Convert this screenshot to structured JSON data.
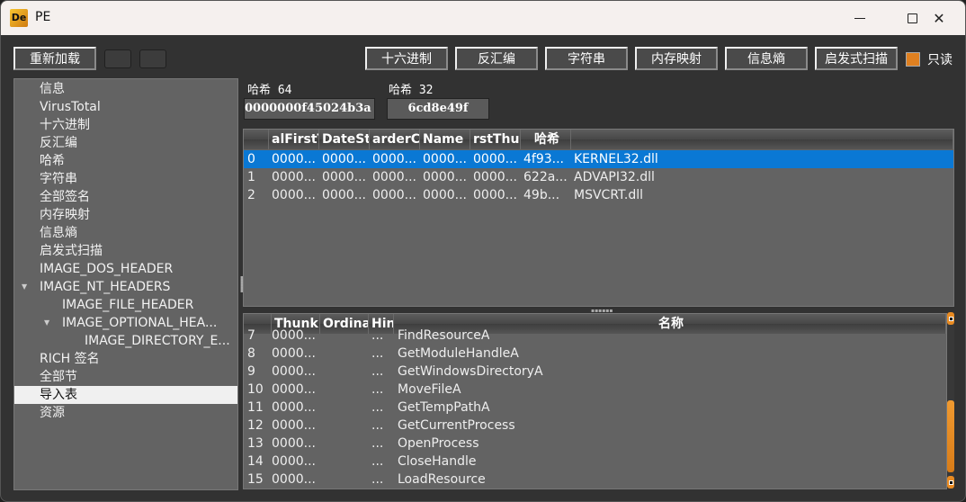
{
  "window": {
    "title": "PE",
    "app_icon": "De",
    "controls": {
      "minimize": "minimize-icon",
      "maximize": "maximize-icon",
      "close": "✕"
    }
  },
  "toolbar": {
    "reload_label": "重新加载",
    "tab_buttons": [
      "十六进制",
      "反汇编",
      "字符串",
      "内存映射",
      "信息熵",
      "启发式扫描"
    ],
    "readonly_label": "只读",
    "readonly_checked": true,
    "accent_color": "#df8020"
  },
  "tree": {
    "items": [
      {
        "label": "信息",
        "level": 0
      },
      {
        "label": "VirusTotal",
        "level": 0
      },
      {
        "label": "十六进制",
        "level": 0
      },
      {
        "label": "反汇编",
        "level": 0
      },
      {
        "label": "哈希",
        "level": 0
      },
      {
        "label": "字符串",
        "level": 0
      },
      {
        "label": "全部签名",
        "level": 0
      },
      {
        "label": "内存映射",
        "level": 0
      },
      {
        "label": "信息熵",
        "level": 0
      },
      {
        "label": "启发式扫描",
        "level": 0
      },
      {
        "label": "IMAGE_DOS_HEADER",
        "level": 0
      },
      {
        "label": "IMAGE_NT_HEADERS",
        "level": 0,
        "expanded": true
      },
      {
        "label": "IMAGE_FILE_HEADER",
        "level": 1
      },
      {
        "label": "IMAGE_OPTIONAL_HEA...",
        "level": 1,
        "expanded": true
      },
      {
        "label": "IMAGE_DIRECTORY_E...",
        "level": 2
      },
      {
        "label": "RICH 签名",
        "level": 0
      },
      {
        "label": "全部节",
        "level": 0
      },
      {
        "label": "导入表",
        "level": 0,
        "selected": true
      },
      {
        "label": "资源",
        "level": 0
      }
    ]
  },
  "hashes": {
    "hash64_label": "哈希 64",
    "hash64_value": "0000000f45024b3a",
    "hash32_label": "哈希 32",
    "hash32_value": "6cd8e49f"
  },
  "imports_table": {
    "columns": [
      "",
      "alFirstT",
      "DateSt",
      "arderC",
      "Name",
      "rstThur",
      "哈希",
      ""
    ],
    "rows": [
      [
        "0",
        "0000...",
        "0000...",
        "0000...",
        "0000...",
        "0000...",
        "4f93...",
        "KERNEL32.dll"
      ],
      [
        "1",
        "0000...",
        "0000...",
        "0000...",
        "0000...",
        "0000...",
        "622a...",
        "ADVAPI32.dll"
      ],
      [
        "2",
        "0000...",
        "0000...",
        "0000...",
        "0000...",
        "0000...",
        "49b...",
        "MSVCRT.dll"
      ]
    ],
    "selected_row": 0
  },
  "functions_table": {
    "columns": [
      "",
      "Thunk",
      "Ordinal",
      "Hin",
      "名称"
    ],
    "rows": [
      [
        "7",
        "0000...",
        "",
        "...",
        "FindResourceA"
      ],
      [
        "8",
        "0000...",
        "",
        "...",
        "GetModuleHandleA"
      ],
      [
        "9",
        "0000...",
        "",
        "...",
        "GetWindowsDirectoryA"
      ],
      [
        "10",
        "0000...",
        "",
        "...",
        "MoveFileA"
      ],
      [
        "11",
        "0000...",
        "",
        "...",
        "GetTempPathA"
      ],
      [
        "12",
        "0000...",
        "",
        "...",
        "GetCurrentProcess"
      ],
      [
        "13",
        "0000...",
        "",
        "...",
        "OpenProcess"
      ],
      [
        "14",
        "0000...",
        "",
        "...",
        "CloseHandle"
      ],
      [
        "15",
        "0000...",
        "",
        "...",
        "LoadResource"
      ]
    ],
    "scroll_position": 0.65
  }
}
